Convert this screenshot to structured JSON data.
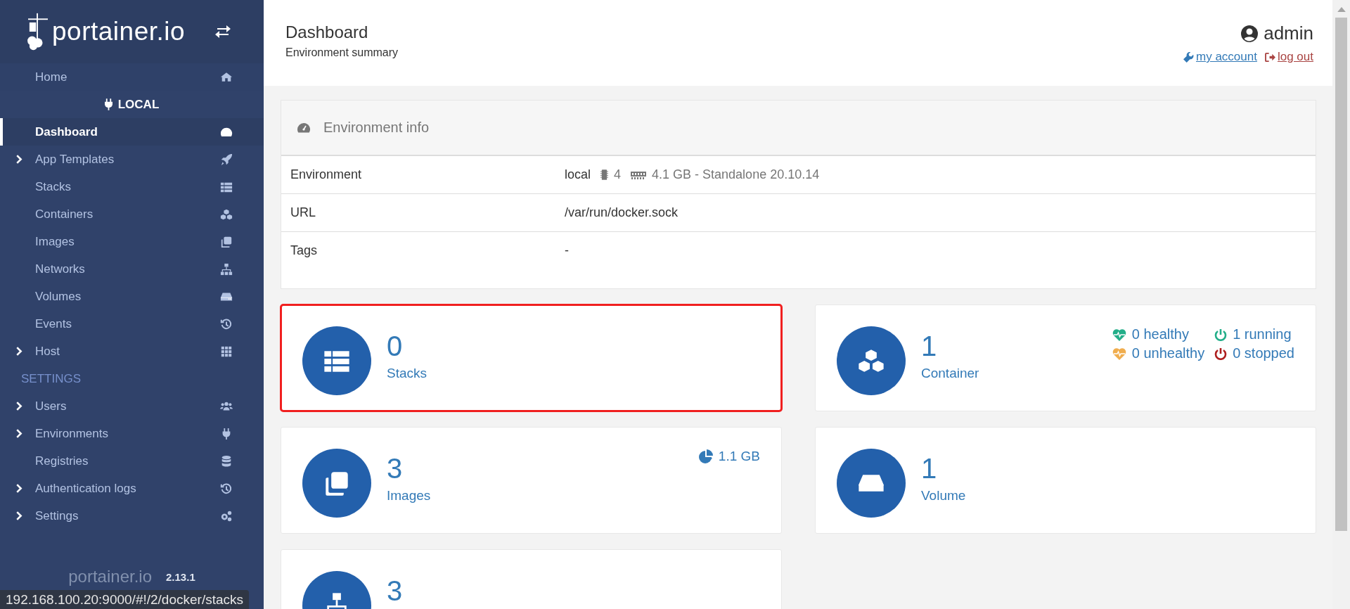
{
  "logo": {
    "text": "portainer.io"
  },
  "sidebar": {
    "top_items": [
      {
        "label": "Home",
        "selected": false
      }
    ],
    "environment": "LOCAL",
    "environment_items": [
      {
        "label": "Dashboard",
        "selected": true,
        "expandable": false
      },
      {
        "label": "App Templates",
        "selected": false,
        "expandable": true
      },
      {
        "label": "Stacks",
        "selected": false,
        "expandable": false
      },
      {
        "label": "Containers",
        "selected": false,
        "expandable": false
      },
      {
        "label": "Images",
        "selected": false,
        "expandable": false
      },
      {
        "label": "Networks",
        "selected": false,
        "expandable": false
      },
      {
        "label": "Volumes",
        "selected": false,
        "expandable": false
      },
      {
        "label": "Events",
        "selected": false,
        "expandable": false
      },
      {
        "label": "Host",
        "selected": false,
        "expandable": true
      }
    ],
    "section": "SETTINGS",
    "settings_items": [
      {
        "label": "Users",
        "selected": false,
        "expandable": true
      },
      {
        "label": "Environments",
        "selected": false,
        "expandable": true
      },
      {
        "label": "Registries",
        "selected": false,
        "expandable": false
      },
      {
        "label": "Authentication logs",
        "selected": false,
        "expandable": true
      },
      {
        "label": "Settings",
        "selected": false,
        "expandable": true
      }
    ]
  },
  "footer": {
    "logo_text": "portainer.io",
    "version": "2.13.1"
  },
  "header": {
    "title": "Dashboard",
    "subtitle": "Environment summary",
    "user": "admin",
    "links": [
      {
        "label": "my account",
        "kind": "account"
      },
      {
        "label": "log out",
        "kind": "logout"
      }
    ]
  },
  "environment_info": {
    "title": "Environment info",
    "rows": [
      {
        "label": "Environment",
        "value": "local",
        "cpu": "4",
        "memory": "4.1 GB - Standalone 20.10.14"
      },
      {
        "label": "URL",
        "value": "/var/run/docker.sock"
      },
      {
        "label": "Tags",
        "value": "-"
      }
    ]
  },
  "tiles": [
    {
      "count": "0",
      "label": "Stacks",
      "highlighted": true
    },
    {
      "count": "1",
      "label": "Container",
      "highlighted": false,
      "stats": [
        {
          "text": "0 healthy",
          "kind": "heart",
          "color": "#23ae89"
        },
        {
          "text": "1 running",
          "kind": "power",
          "color": "#23ae89"
        },
        {
          "text": "0 unhealthy",
          "kind": "heart",
          "color": "#f0ad4e"
        },
        {
          "text": "0 stopped",
          "kind": "power",
          "color": "#ae1f1f"
        }
      ]
    },
    {
      "count": "3",
      "label": "Images",
      "highlighted": false,
      "size": "1.1 GB"
    },
    {
      "count": "1",
      "label": "Volume",
      "highlighted": false
    },
    {
      "count": "3",
      "highlighted": false
    }
  ],
  "status_url": "192.168.100.20:9000/#!/2/docker/stacks"
}
